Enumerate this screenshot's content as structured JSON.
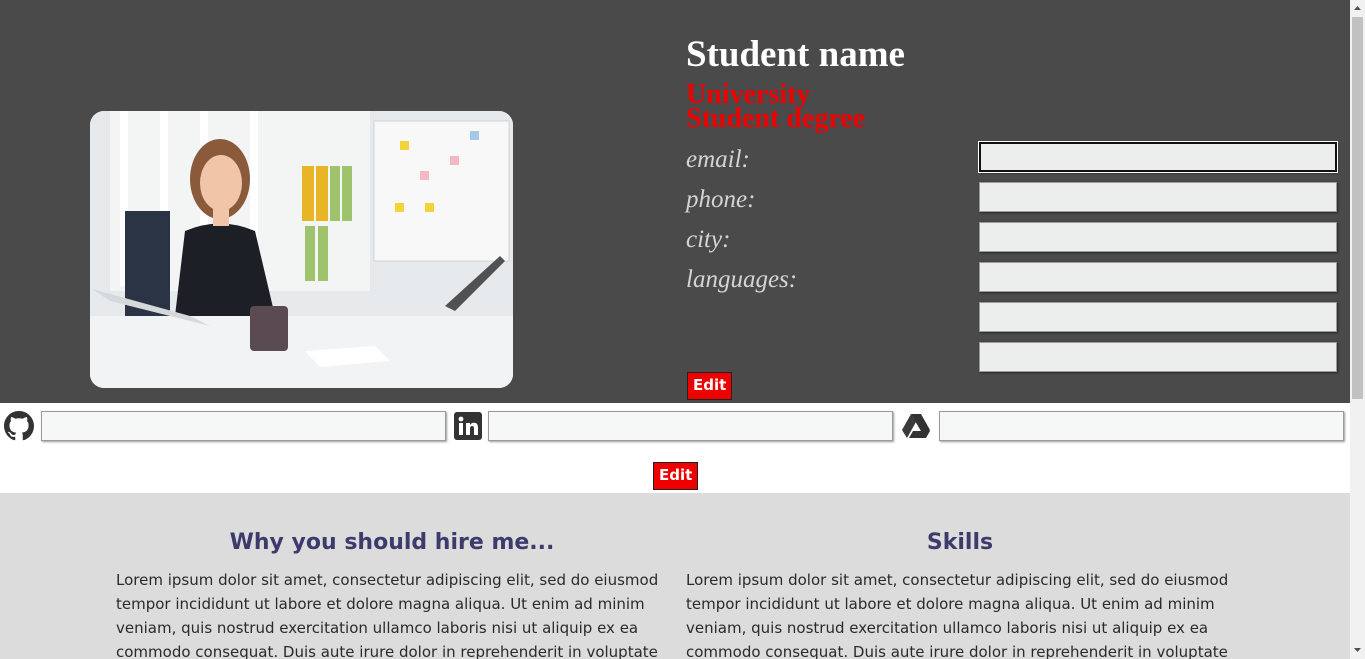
{
  "profile": {
    "name": "Student name",
    "university": "University",
    "degree": "Student degree",
    "photo_alt": "student-photo",
    "labels": {
      "email": "email:",
      "phone": "phone:",
      "city": "city:",
      "languages": "languages:"
    },
    "edit_label": "Edit"
  },
  "social": {
    "icons": [
      "github-icon",
      "linkedin-icon",
      "google-drive-icon"
    ],
    "edit_label": "Edit"
  },
  "sections": {
    "hire": {
      "title": "Why you should hire me...",
      "text": "Lorem ipsum dolor sit amet, consectetur adipiscing elit, sed do eiusmod tempor incididunt ut labore et dolore magna aliqua. Ut enim ad minim veniam, quis nostrud exercitation ullamco laboris nisi ut aliquip ex ea commodo consequat. Duis aute irure dolor in reprehenderit in voluptate velit"
    },
    "skills": {
      "title": "Skills",
      "text": "Lorem ipsum dolor sit amet, consectetur adipiscing elit, sed do eiusmod tempor incididunt ut labore et dolore magna aliqua. Ut enim ad minim veniam, quis nostrud exercitation ullamco laboris nisi ut aliquip ex ea commodo consequat. Duis aute irure dolor in reprehenderit in voluptate velit"
    }
  },
  "colors": {
    "header_bg": "#4a4a4a",
    "accent_red": "#ee0000",
    "heading": "#3d3b6b",
    "lower_bg": "#dcdcdc"
  }
}
